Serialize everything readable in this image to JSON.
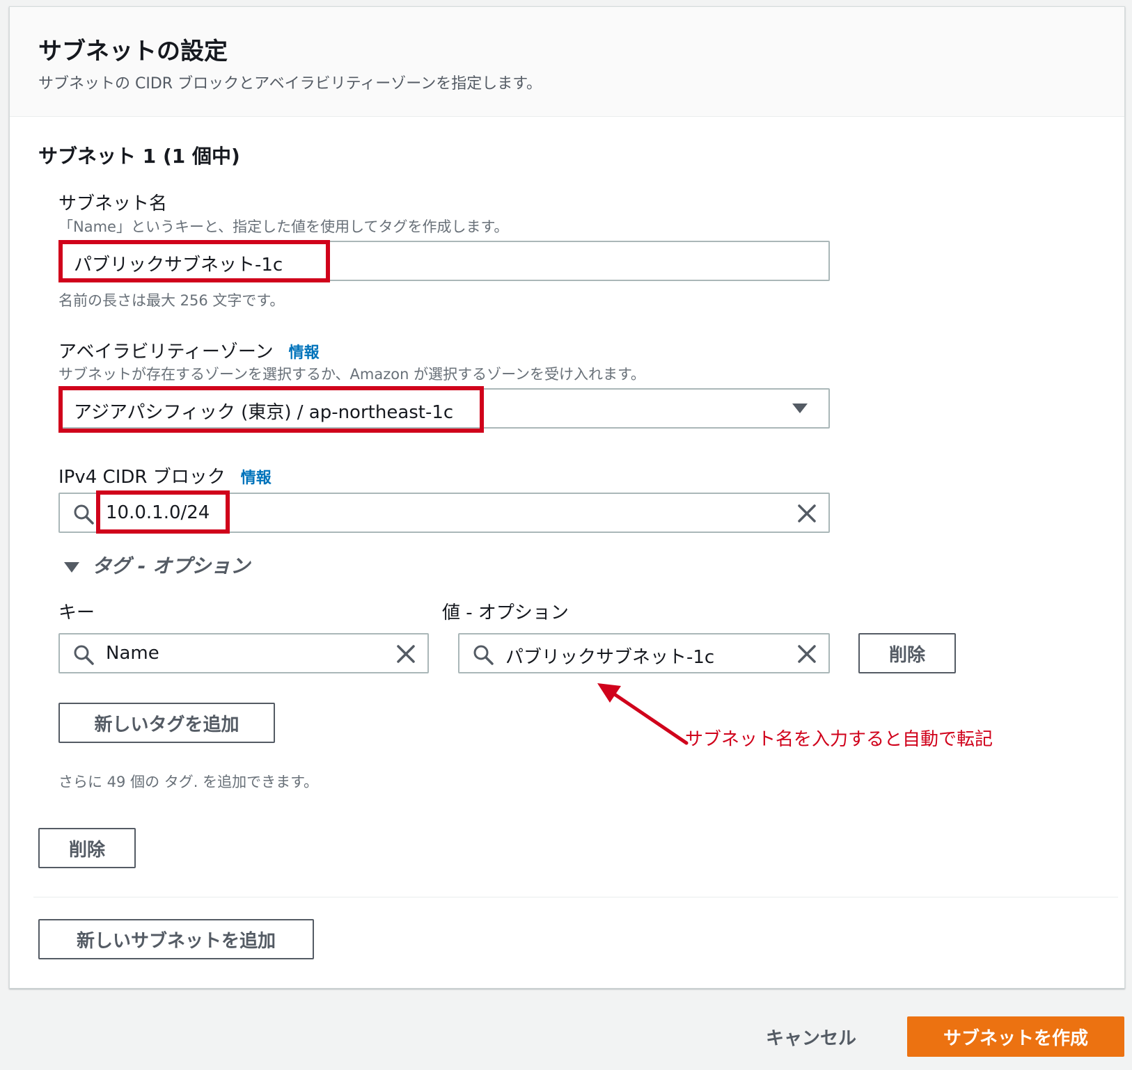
{
  "panel": {
    "title": "サブネットの設定",
    "description": "サブネットの CIDR ブロックとアベイラビリティーゾーンを指定します。"
  },
  "subnet": {
    "heading": "サブネット 1 (1 個中)",
    "name": {
      "label": "サブネット名",
      "description": "「Name」というキーと、指定した値を使用してタグを作成します。",
      "value": "パブリックサブネット-1c",
      "constraint": "名前の長さは最大 256 文字です。"
    },
    "az": {
      "label": "アベイラビリティーゾーン",
      "info": "情報",
      "description": "サブネットが存在するゾーンを選択するか、Amazon が選択するゾーンを受け入れます。",
      "value": "アジアパシフィック (東京) / ap-northeast-1c"
    },
    "cidr": {
      "label": "IPv4 CIDR ブロック",
      "info": "情報",
      "value": "10.0.1.0/24"
    },
    "tags": {
      "section_label": "タグ - オプション",
      "key_label": "キー",
      "value_label": "値 - オプション",
      "key_value": "Name",
      "value_value": "パブリックサブネット-1c",
      "remove_tag": "削除",
      "add_tag": "新しいタグを追加",
      "remaining": "さらに 49 個の タグ. を追加できます。"
    },
    "remove_subnet": "削除"
  },
  "add_subnet": "新しいサブネットを追加",
  "annotation": "サブネット名を入力すると自動で転記",
  "footer": {
    "cancel": "キャンセル",
    "create": "サブネットを作成"
  },
  "colors": {
    "highlight": "#d0021b",
    "primary": "#ec7211",
    "link": "#0073bb"
  }
}
